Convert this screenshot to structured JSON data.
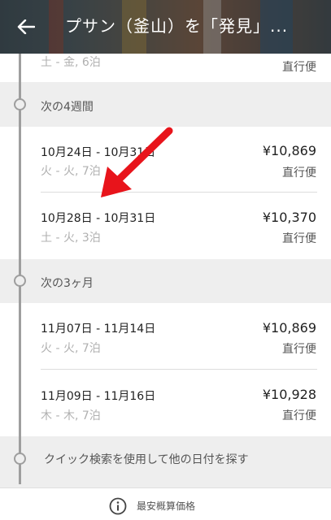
{
  "header": {
    "title": "プサン（釜山）を「発見」..."
  },
  "top_partial": {
    "sub": "土 - 金, 6泊",
    "type": "直行便"
  },
  "sections": [
    {
      "label": "次の4週間",
      "rows": [
        {
          "dates": "10月24日 - 10月31日",
          "sub": "火 - 火, 7泊",
          "price": "¥10,869",
          "type": "直行便"
        },
        {
          "dates": "10月28日 - 10月31日",
          "sub": "土 - 火, 3泊",
          "price": "¥10,370",
          "type": "直行便"
        }
      ]
    },
    {
      "label": "次の3ヶ月",
      "rows": [
        {
          "dates": "11月07日 - 11月14日",
          "sub": "火 - 火, 7泊",
          "price": "¥10,869",
          "type": "直行便"
        },
        {
          "dates": "11月09日 - 11月16日",
          "sub": "木 - 木, 7泊",
          "price": "¥10,928",
          "type": "直行便"
        }
      ]
    }
  ],
  "quick_search": "クイック検索を使用して他の日付を探す",
  "footer": {
    "label": "最安概算価格",
    "icon": "info-icon"
  },
  "colors": {
    "annotation_arrow": "#e8141b"
  }
}
